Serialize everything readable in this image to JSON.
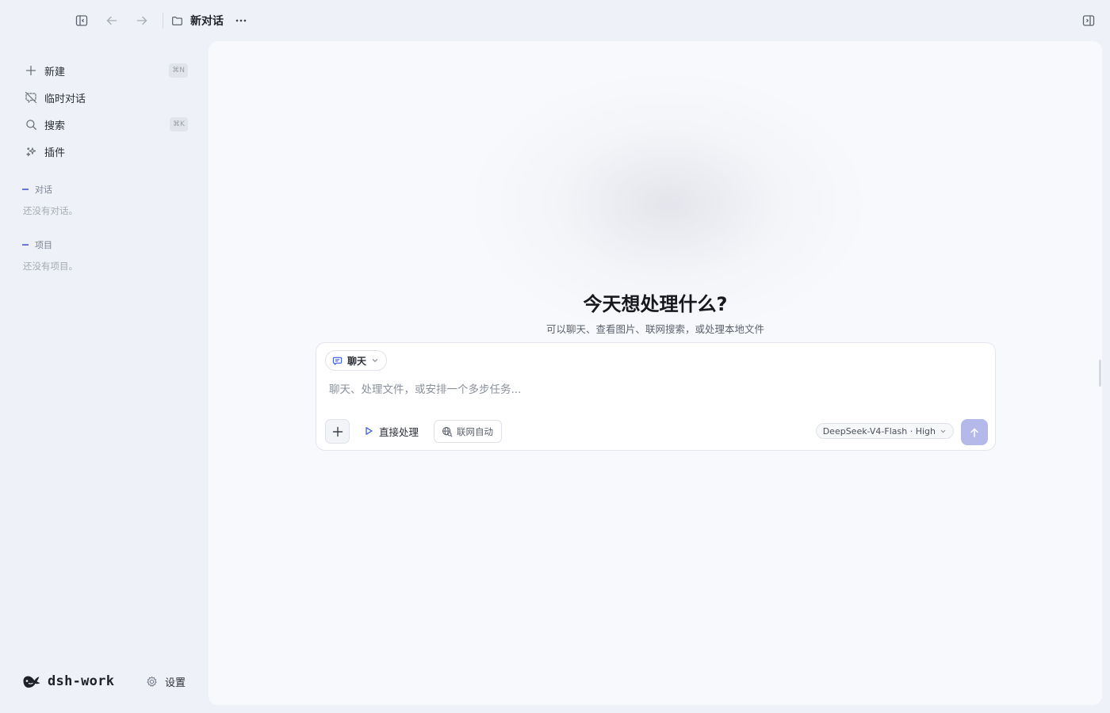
{
  "header": {
    "title": "新对话",
    "icons": [
      "sidebar-toggle-icon",
      "back-arrow-icon",
      "forward-arrow-icon",
      "folder-icon",
      "more-icon",
      "right-panel-icon"
    ]
  },
  "sidebar": {
    "items": [
      {
        "label": "新建",
        "icon": "plus-icon",
        "shortcut": "⌘N"
      },
      {
        "label": "临时对话",
        "icon": "temporary-chat-icon",
        "shortcut": ""
      },
      {
        "label": "搜索",
        "icon": "search-icon",
        "shortcut": "⌘K"
      },
      {
        "label": "插件",
        "icon": "sparkle-icon",
        "shortcut": ""
      }
    ],
    "sections": [
      {
        "title": "对话",
        "empty": "还没有对话。"
      },
      {
        "title": "项目",
        "empty": "还没有项目。"
      }
    ],
    "brand": "dsh-work",
    "settings_label": "设置"
  },
  "main": {
    "title": "今天想处理什么?",
    "subtitle": "可以聊天、查看图片、联网搜索，或处理本地文件",
    "composer": {
      "mode_label": "聊天",
      "placeholder": "聊天、处理文件，或安排一个多步任务...",
      "direct_label": "直接处理",
      "web_label": "联网自动",
      "model_label": "DeepSeek-V4-Flash · High"
    }
  },
  "colors": {
    "accent": "#6b74d9",
    "send_button": "#b4b9ea",
    "background": "#eef1f7",
    "panel": "#f8f9fc"
  }
}
